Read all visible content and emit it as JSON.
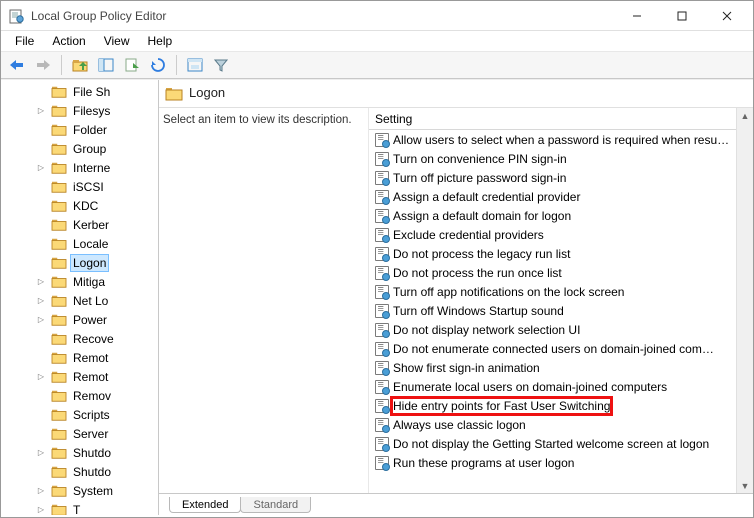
{
  "window": {
    "title": "Local Group Policy Editor"
  },
  "menubar": [
    "File",
    "Action",
    "View",
    "Help"
  ],
  "tree": [
    {
      "label": "File Sh",
      "children": false
    },
    {
      "label": "Filesys",
      "children": true
    },
    {
      "label": "Folder",
      "children": false
    },
    {
      "label": "Group",
      "children": false
    },
    {
      "label": "Interne",
      "children": true
    },
    {
      "label": "iSCSI",
      "children": false
    },
    {
      "label": "KDC",
      "children": false
    },
    {
      "label": "Kerber",
      "children": false
    },
    {
      "label": "Locale",
      "children": false
    },
    {
      "label": "Logon",
      "children": false,
      "selected": true
    },
    {
      "label": "Mitiga",
      "children": true
    },
    {
      "label": "Net Lo",
      "children": true
    },
    {
      "label": "Power",
      "children": true
    },
    {
      "label": "Recove",
      "children": false
    },
    {
      "label": "Remot",
      "children": false
    },
    {
      "label": "Remot",
      "children": true
    },
    {
      "label": "Remov",
      "children": false
    },
    {
      "label": "Scripts",
      "children": false
    },
    {
      "label": "Server",
      "children": false
    },
    {
      "label": "Shutdo",
      "children": true
    },
    {
      "label": "Shutdo",
      "children": false
    },
    {
      "label": "System",
      "children": true
    },
    {
      "label": "T",
      "children": true
    }
  ],
  "main": {
    "header": "Logon",
    "description": "Select an item to view its description.",
    "list_header": "Setting",
    "settings": [
      "Allow users to select when a password is required when resu…",
      "Turn on convenience PIN sign-in",
      "Turn off picture password sign-in",
      "Assign a default credential provider",
      "Assign a default domain for logon",
      "Exclude credential providers",
      "Do not process the legacy run list",
      "Do not process the run once list",
      "Turn off app notifications on the lock screen",
      "Turn off Windows Startup sound",
      "Do not display network selection UI",
      "Do not enumerate connected users on domain-joined com…",
      "Show first sign-in animation",
      "Enumerate local users on domain-joined computers",
      "Hide entry points for Fast User Switching",
      "Always use classic logon",
      "Do not display the Getting Started welcome screen at logon",
      "Run these programs at user logon"
    ],
    "highlighted_index": 14
  },
  "tabs": [
    "Extended",
    "Standard"
  ],
  "active_tab": 0
}
